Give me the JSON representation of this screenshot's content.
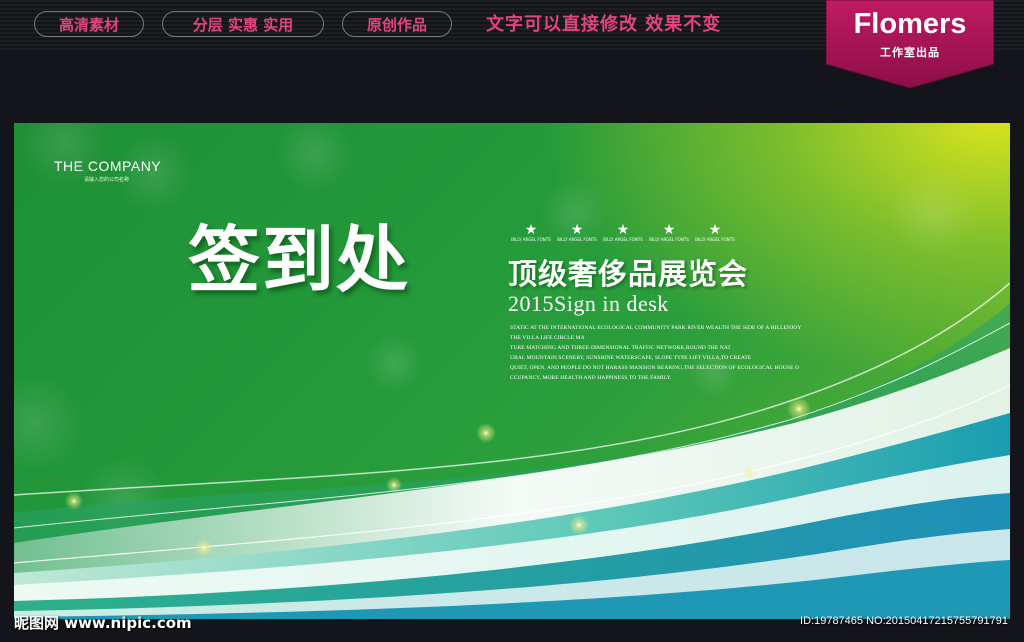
{
  "header": {
    "pills": [
      "高清素材",
      "分层 实惠 实用",
      "原创作品"
    ],
    "slogan": "文字可以直接修改  效果不变",
    "brand_name": "Flomers",
    "brand_sub": "工作室出品",
    "accent_color": "#e2457c",
    "brand_color": "#b8145c"
  },
  "poster": {
    "company_name": "THE COMPANY",
    "company_sub": "请输入您的公司名称",
    "title": "签到处",
    "star_labels": [
      "BILLY ARGEL FONTS",
      "BILLY ARGEL FONTS",
      "BILLY ARGEL FONTS",
      "BILLY ARGEL FONTS",
      "BILLY ARGEL FONTS"
    ],
    "subtitle": "顶级奢侈品展览会",
    "sign_line": "2015Sign in desk",
    "paragraph": [
      "STATIC AT THE INTERNATIONAL ECOLOGICAL COMMUNITY PARK RIVER WEALTH THE SIDE OF A HILLENJOY",
      "THE VILLA LIFE CIRCLE MA",
      "TURE MATCHING AND THREE-DIMENSIONAL TRAFFIC NETWORK,ROUND THE NAT",
      "URAL MOUNTAIN SCENERY, SUNSHINE WATERSCAPE, SLOPE TYPE LIFT VILLA,TO CREATE",
      "QUIET, OPEN, AND PEOPLE DO NOT HARASS MANSION BEARING,THE SELECTION OF ECOLOGICAL HOUSE O",
      "CCUPANCY, MORE HEALTH AND HAPPINESS TO THE FAMILY."
    ]
  },
  "footer": {
    "watermark_left": "昵图网 www.nipic.com",
    "watermark_right": "ID:19787465 NO:20150417215755791791"
  }
}
